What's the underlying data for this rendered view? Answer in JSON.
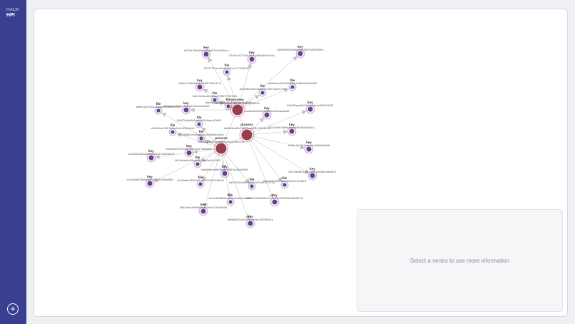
{
  "app": {
    "logo_line1": "HACK",
    "logo_line2": "HPI",
    "add_icon": "+"
  },
  "info_panel": {
    "placeholder": "Select a vertex to see more information"
  },
  "colors": {
    "sidebar": "#3b3f8f",
    "process_node": "#9b3d4f",
    "vertex_node": "#6a3d8f",
    "edge": "#c8c8cc"
  },
  "graph": {
    "vertices": [
      {
        "type": "process",
        "id": "e6db96b13a89870527101e509622a",
        "kind": "process"
      },
      {
        "type": "process",
        "id": "6d62834e62c7d873ea693b740f25e25",
        "kind": "process"
      },
      {
        "type": "process",
        "id": "0c92686d8839eae8671468d2159122b",
        "kind": "process"
      },
      {
        "type": "key",
        "id": "837f5e79fed86b4d9da0f7b2c8594ce",
        "kind": "key"
      },
      {
        "type": "key",
        "id": "51e61e5217c3c14e13dd818f0e42ec1",
        "kind": "key"
      },
      {
        "type": "key",
        "id": "e8b9080694d6a3b1f038e74c6f23990c",
        "kind": "key"
      },
      {
        "type": "file",
        "id": "95722714aca6449a03c4ec774230c52",
        "kind": "file"
      },
      {
        "type": "key",
        "id": "ffc6fcb17860b5a5d7f3057063c17cf",
        "kind": "key"
      },
      {
        "type": "file",
        "id": "4d412d3da48c133c272697757210fd",
        "kind": "file"
      },
      {
        "type": "file",
        "id": "621988143913d0c4574425 4d2e1794",
        "kind": "file"
      },
      {
        "type": "file",
        "id": "a82d6dca3b11834f5864b862eb618e859",
        "kind": "file"
      },
      {
        "type": "key",
        "id": "b26262ea464040c0db6ccc0f60296951",
        "kind": "key"
      },
      {
        "type": "key",
        "id": "c757d2ce45e0e7344b0f7b3d1e3ae801",
        "kind": "key"
      },
      {
        "type": "file",
        "id": "6f6fb1ac037ea143fa62b05b8b81934",
        "kind": "file"
      },
      {
        "type": "file",
        "id": "d8bc3d9d1f5b5f7473146d34a8ba3cf2",
        "kind": "file"
      },
      {
        "type": "key",
        "id": "a4cf6d6e09a200658091616ca6a6a8",
        "kind": "key"
      },
      {
        "type": "file",
        "id": "16f672c8da966de86900d9ae142b3f1",
        "kind": "file"
      },
      {
        "type": "file",
        "id": "c65d494dc7827c6bc6c4e4f3b3c0e5",
        "kind": "file"
      },
      {
        "type": "file",
        "id": "9d0f688b2e65da6e20d44ef5d44b5c6",
        "kind": "file"
      },
      {
        "type": "key",
        "id": "1152495b766d6d6ca8606cf5c5d184c7",
        "kind": "key"
      },
      {
        "type": "key",
        "id": "e182e197d47eabe31af49d40fafdff",
        "kind": "key"
      },
      {
        "type": "key",
        "id": "0c64ea4767b2dd0770bb7017ab0d60e",
        "kind": "key"
      },
      {
        "type": "key",
        "id": "b3c00ac1522a6695f76a1f27d2510512",
        "kind": "key"
      },
      {
        "type": "file",
        "id": "4b29a6ad4c1f8edd5b34e63a3fc7d3f3",
        "kind": "file"
      },
      {
        "type": "key",
        "id": "dcf70ddd6e13ec7a5f219ed61bcad3521",
        "kind": "key"
      },
      {
        "type": "key",
        "id": "0ab4ea0e4d6453ad7f6557ea48a0b064",
        "kind": "key"
      },
      {
        "type": "key",
        "id": "b2c6c5df678b6a66e7251887d65d4f9b",
        "kind": "key"
      },
      {
        "type": "file",
        "id": "3ebc100f7ddcbd5692a511e11e4ebe",
        "kind": "file"
      },
      {
        "type": "file",
        "id": "4b42ad6c935948 1eb8600a131f45e2d",
        "kind": "file"
      },
      {
        "type": "file",
        "id": "6a07f06b2d49c5665b32f7bdf2d7974a",
        "kind": "file"
      },
      {
        "type": "file",
        "id": "7aeea6b98580c2f6543cd6e5aa30a1",
        "kind": "file"
      },
      {
        "type": "key",
        "id": "a8f77b02d9465f7a1c774f4e3354f7b0d8d56744",
        "kind": "key"
      },
      {
        "type": "key",
        "id": "8863deec6b998d8cad3ee8 1fa7fc8205",
        "kind": "key"
      },
      {
        "type": "key",
        "id": "6bfc8fb025a292442ee0ec1f5004641d",
        "kind": "key"
      }
    ]
  }
}
